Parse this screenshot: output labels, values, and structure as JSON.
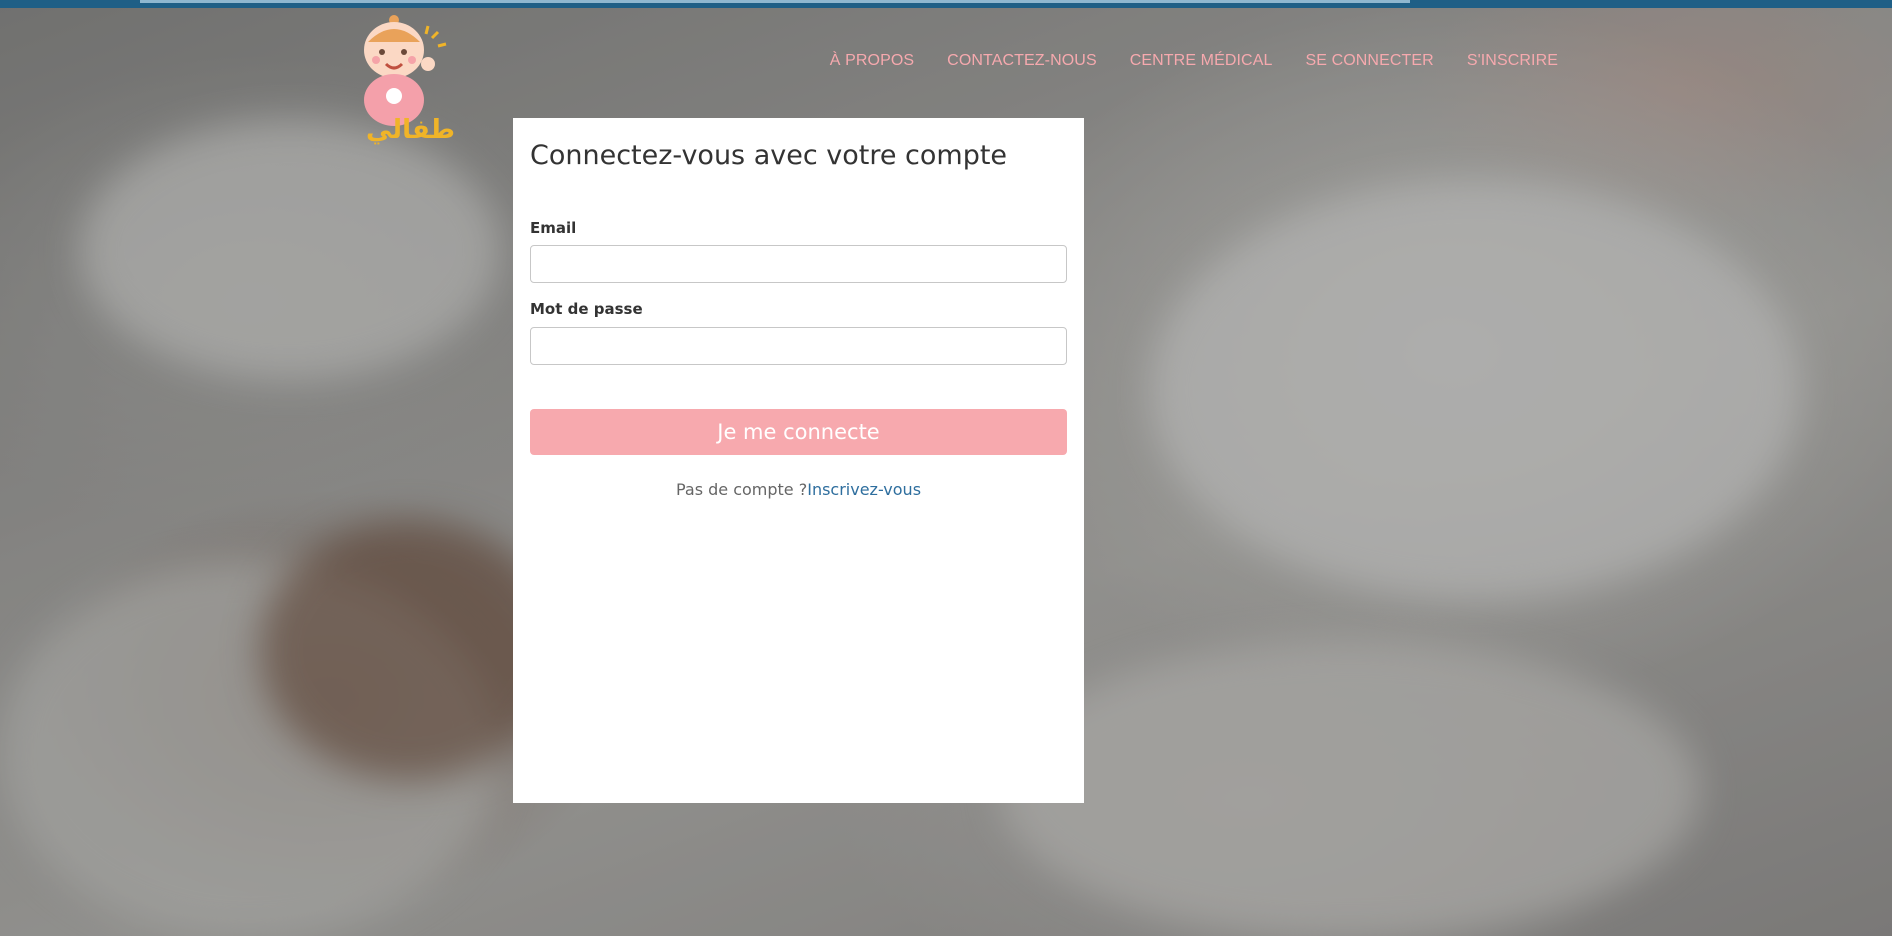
{
  "nav": {
    "items": [
      {
        "label": "À PROPOS"
      },
      {
        "label": "CONTACTEZ-NOUS"
      },
      {
        "label": "CENTRE MÉDICAL"
      },
      {
        "label": "SE CONNECTER"
      },
      {
        "label": "S'INSCRIRE"
      }
    ]
  },
  "logo": {
    "icon": "baby-logo-icon",
    "text": "اطفالي"
  },
  "login": {
    "title": "Connectez-vous avec votre compte",
    "email_label": "Email",
    "email_value": "",
    "password_label": "Mot de passe",
    "password_value": "",
    "submit_label": "Je me connecte",
    "no_account_text": "Pas de compte ?",
    "signup_link": "Inscrivez-vous"
  },
  "colors": {
    "accent_pink": "#f7a9ae",
    "link_blue": "#2e6e9e",
    "topbar": "#1f5f86"
  }
}
